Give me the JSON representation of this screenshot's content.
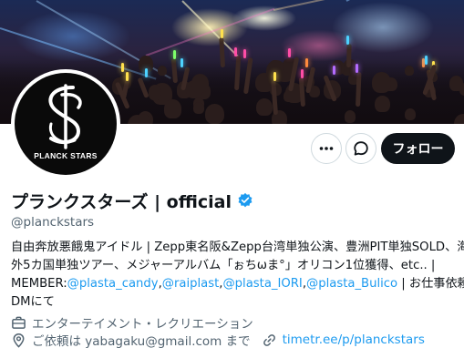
{
  "profile": {
    "display_name": "プランクスターズ | official",
    "handle": "@planckstars",
    "avatar_text": "PLANCK STARS",
    "follow_label": "フォロー",
    "bio": {
      "line1": "自由奔放悪餓鬼アイドル | Zepp東名阪&Zepp台湾単独公演、豊洲PIT単独SOLD、海",
      "line2": "外5カ国単独ツアー、メジャーアルバム「ぉちωま°」オリコン1位獲得、etc.. |",
      "line3_prefix": "MEMBER:",
      "mentions": [
        "@plasta_candy",
        "@raiplast",
        "@plasta_IORI",
        "@plasta_Bulico"
      ],
      "line3_suffix": " | お仕事依頼は",
      "line4": "DMにて"
    },
    "category": "エンターテイメント・レクリエーション",
    "location": "ご依頼は yabagaku@gmail.com まで",
    "website": "timetr.ee/p/planckstars"
  },
  "colors": {
    "accent": "#1d9bf0",
    "text": "#0f1419",
    "secondary": "#536471",
    "follow_bg": "#0f1419"
  },
  "icons": {
    "more": "more-icon",
    "message": "message-icon",
    "verified": "verified-badge-icon",
    "category": "briefcase-icon",
    "location": "location-pin-icon",
    "website": "link-icon"
  }
}
